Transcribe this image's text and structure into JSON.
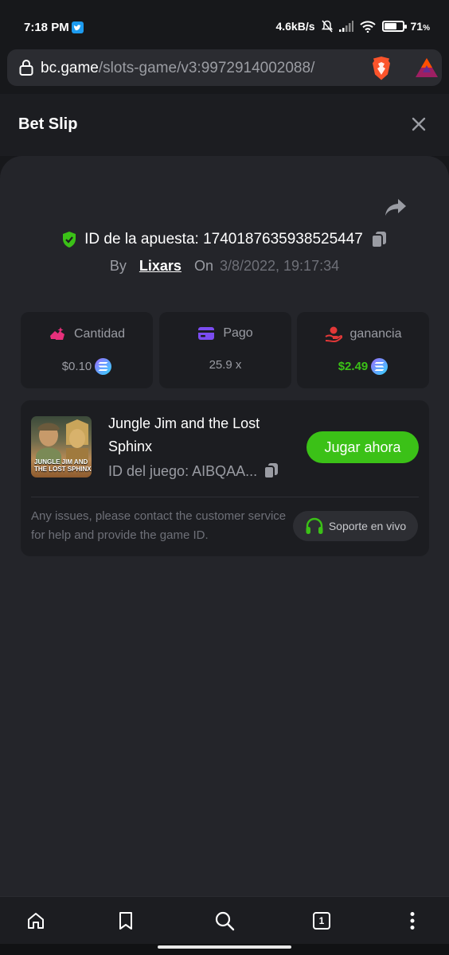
{
  "status_bar": {
    "time": "7:18 PM",
    "network_speed": "4.6kB/s",
    "battery": "71",
    "battery_level": 0.71
  },
  "browser": {
    "url_host": "bc.game",
    "url_path": "/slots-game/v3:9972914002088/"
  },
  "header": {
    "title": "Bet Slip"
  },
  "bet": {
    "id_label": "ID de la apuesta: 1740187635938525447",
    "by_label": "By",
    "user": "Lixars",
    "on_label": "On",
    "date": "3/8/2022, 19:17:34"
  },
  "stats": {
    "amount_label": "Cantidad",
    "amount_value": "$0.10",
    "payout_label": "Pago",
    "payout_value": "25.9 x",
    "profit_label": "ganancia",
    "profit_value": "$2.49"
  },
  "game": {
    "name": "Jungle Jim and the Lost Sphinx",
    "id_label": "ID del juego: AIBQAA...",
    "thumb_text": "JUNGLE JIM AND THE LOST SPHINX",
    "play_label": "Jugar ahora",
    "notice": "Any issues, please contact the customer service for help and provide the game ID.",
    "support_label": "Soporte en vivo"
  },
  "bottom_nav": {
    "tabs_count": "1"
  },
  "colors": {
    "accent_green": "#3bc117",
    "panel": "#24252a",
    "card": "#1c1d21"
  }
}
